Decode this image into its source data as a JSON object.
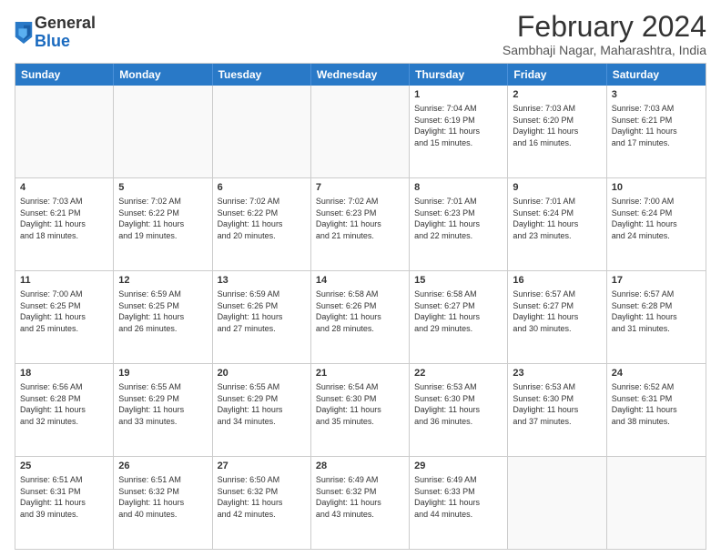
{
  "logo": {
    "general": "General",
    "blue": "Blue"
  },
  "title": "February 2024",
  "subtitle": "Sambhaji Nagar, Maharashtra, India",
  "headers": [
    "Sunday",
    "Monday",
    "Tuesday",
    "Wednesday",
    "Thursday",
    "Friday",
    "Saturday"
  ],
  "weeks": [
    [
      {
        "day": "",
        "info": ""
      },
      {
        "day": "",
        "info": ""
      },
      {
        "day": "",
        "info": ""
      },
      {
        "day": "",
        "info": ""
      },
      {
        "day": "1",
        "info": "Sunrise: 7:04 AM\nSunset: 6:19 PM\nDaylight: 11 hours\nand 15 minutes."
      },
      {
        "day": "2",
        "info": "Sunrise: 7:03 AM\nSunset: 6:20 PM\nDaylight: 11 hours\nand 16 minutes."
      },
      {
        "day": "3",
        "info": "Sunrise: 7:03 AM\nSunset: 6:21 PM\nDaylight: 11 hours\nand 17 minutes."
      }
    ],
    [
      {
        "day": "4",
        "info": "Sunrise: 7:03 AM\nSunset: 6:21 PM\nDaylight: 11 hours\nand 18 minutes."
      },
      {
        "day": "5",
        "info": "Sunrise: 7:02 AM\nSunset: 6:22 PM\nDaylight: 11 hours\nand 19 minutes."
      },
      {
        "day": "6",
        "info": "Sunrise: 7:02 AM\nSunset: 6:22 PM\nDaylight: 11 hours\nand 20 minutes."
      },
      {
        "day": "7",
        "info": "Sunrise: 7:02 AM\nSunset: 6:23 PM\nDaylight: 11 hours\nand 21 minutes."
      },
      {
        "day": "8",
        "info": "Sunrise: 7:01 AM\nSunset: 6:23 PM\nDaylight: 11 hours\nand 22 minutes."
      },
      {
        "day": "9",
        "info": "Sunrise: 7:01 AM\nSunset: 6:24 PM\nDaylight: 11 hours\nand 23 minutes."
      },
      {
        "day": "10",
        "info": "Sunrise: 7:00 AM\nSunset: 6:24 PM\nDaylight: 11 hours\nand 24 minutes."
      }
    ],
    [
      {
        "day": "11",
        "info": "Sunrise: 7:00 AM\nSunset: 6:25 PM\nDaylight: 11 hours\nand 25 minutes."
      },
      {
        "day": "12",
        "info": "Sunrise: 6:59 AM\nSunset: 6:25 PM\nDaylight: 11 hours\nand 26 minutes."
      },
      {
        "day": "13",
        "info": "Sunrise: 6:59 AM\nSunset: 6:26 PM\nDaylight: 11 hours\nand 27 minutes."
      },
      {
        "day": "14",
        "info": "Sunrise: 6:58 AM\nSunset: 6:26 PM\nDaylight: 11 hours\nand 28 minutes."
      },
      {
        "day": "15",
        "info": "Sunrise: 6:58 AM\nSunset: 6:27 PM\nDaylight: 11 hours\nand 29 minutes."
      },
      {
        "day": "16",
        "info": "Sunrise: 6:57 AM\nSunset: 6:27 PM\nDaylight: 11 hours\nand 30 minutes."
      },
      {
        "day": "17",
        "info": "Sunrise: 6:57 AM\nSunset: 6:28 PM\nDaylight: 11 hours\nand 31 minutes."
      }
    ],
    [
      {
        "day": "18",
        "info": "Sunrise: 6:56 AM\nSunset: 6:28 PM\nDaylight: 11 hours\nand 32 minutes."
      },
      {
        "day": "19",
        "info": "Sunrise: 6:55 AM\nSunset: 6:29 PM\nDaylight: 11 hours\nand 33 minutes."
      },
      {
        "day": "20",
        "info": "Sunrise: 6:55 AM\nSunset: 6:29 PM\nDaylight: 11 hours\nand 34 minutes."
      },
      {
        "day": "21",
        "info": "Sunrise: 6:54 AM\nSunset: 6:30 PM\nDaylight: 11 hours\nand 35 minutes."
      },
      {
        "day": "22",
        "info": "Sunrise: 6:53 AM\nSunset: 6:30 PM\nDaylight: 11 hours\nand 36 minutes."
      },
      {
        "day": "23",
        "info": "Sunrise: 6:53 AM\nSunset: 6:30 PM\nDaylight: 11 hours\nand 37 minutes."
      },
      {
        "day": "24",
        "info": "Sunrise: 6:52 AM\nSunset: 6:31 PM\nDaylight: 11 hours\nand 38 minutes."
      }
    ],
    [
      {
        "day": "25",
        "info": "Sunrise: 6:51 AM\nSunset: 6:31 PM\nDaylight: 11 hours\nand 39 minutes."
      },
      {
        "day": "26",
        "info": "Sunrise: 6:51 AM\nSunset: 6:32 PM\nDaylight: 11 hours\nand 40 minutes."
      },
      {
        "day": "27",
        "info": "Sunrise: 6:50 AM\nSunset: 6:32 PM\nDaylight: 11 hours\nand 42 minutes."
      },
      {
        "day": "28",
        "info": "Sunrise: 6:49 AM\nSunset: 6:32 PM\nDaylight: 11 hours\nand 43 minutes."
      },
      {
        "day": "29",
        "info": "Sunrise: 6:49 AM\nSunset: 6:33 PM\nDaylight: 11 hours\nand 44 minutes."
      },
      {
        "day": "",
        "info": ""
      },
      {
        "day": "",
        "info": ""
      }
    ]
  ]
}
